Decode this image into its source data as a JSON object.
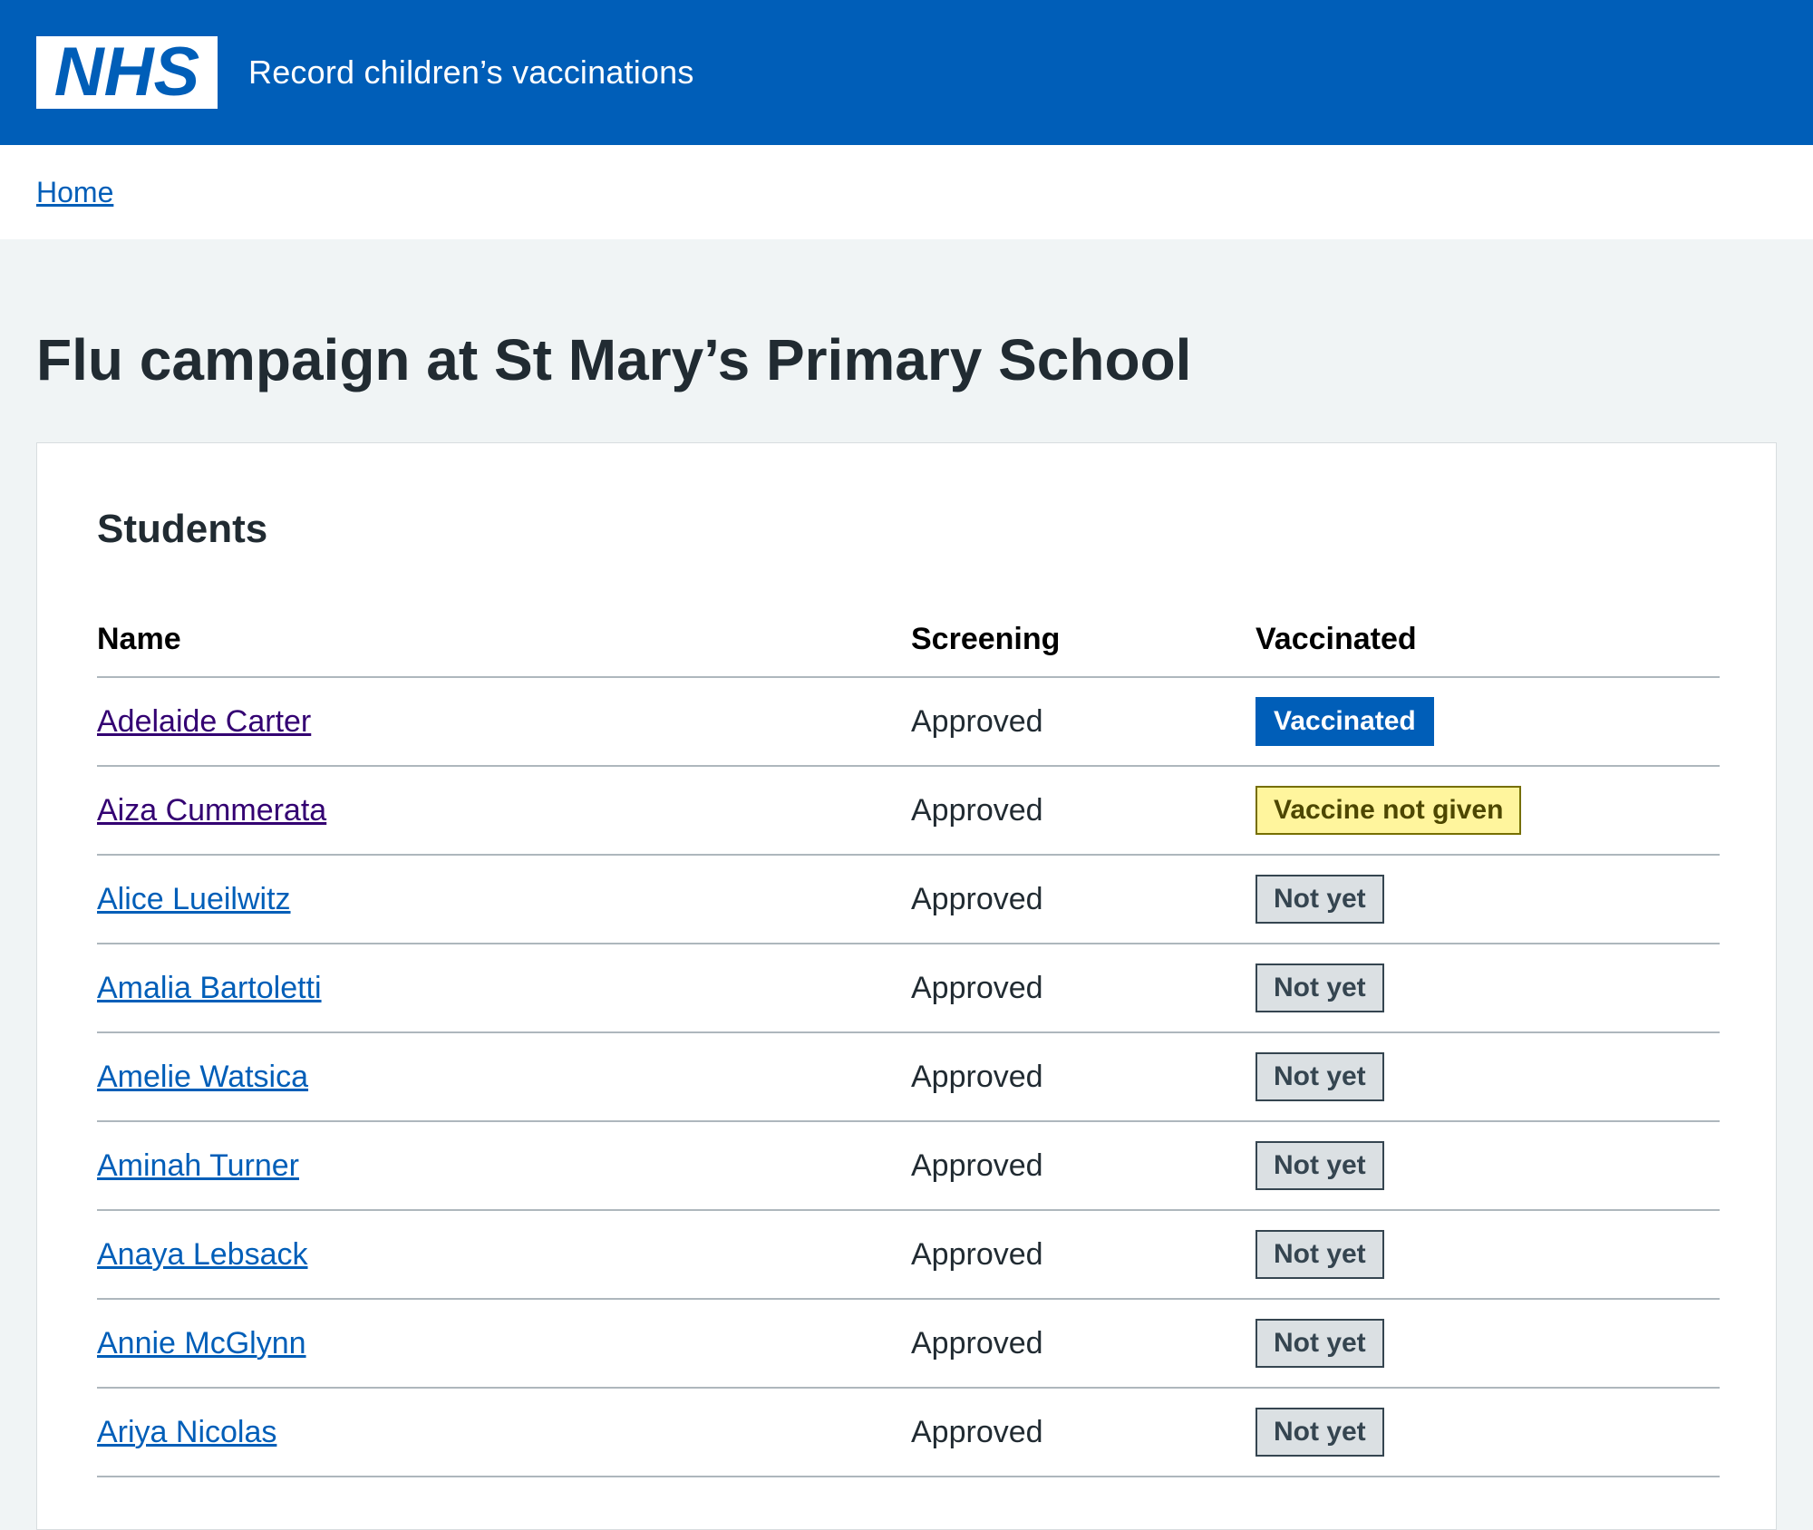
{
  "header": {
    "logo_text": "NHS",
    "service_name": "Record children’s vaccinations"
  },
  "breadcrumb": {
    "home": "Home"
  },
  "page_title": "Flu campaign at St Mary’s Primary School",
  "students": {
    "heading": "Students",
    "columns": [
      "Name",
      "Screening",
      "Vaccinated"
    ],
    "rows": [
      {
        "name": "Adelaide Carter",
        "screening": "Approved",
        "vaccinated": "Vaccinated"
      },
      {
        "name": "Aiza Cummerata",
        "screening": "Approved",
        "vaccinated": "Vaccine not given"
      },
      {
        "name": "Alice Lueilwitz",
        "screening": "Approved",
        "vaccinated": "Not yet"
      },
      {
        "name": "Amalia Bartoletti",
        "screening": "Approved",
        "vaccinated": "Not yet"
      },
      {
        "name": "Amelie Watsica",
        "screening": "Approved",
        "vaccinated": "Not yet"
      },
      {
        "name": "Aminah Turner",
        "screening": "Approved",
        "vaccinated": "Not yet"
      },
      {
        "name": "Anaya Lebsack",
        "screening": "Approved",
        "vaccinated": "Not yet"
      },
      {
        "name": "Annie McGlynn",
        "screening": "Approved",
        "vaccinated": "Not yet"
      },
      {
        "name": "Ariya Nicolas",
        "screening": "Approved",
        "vaccinated": "Not yet"
      }
    ]
  },
  "colors": {
    "header_blue": "#005eb8",
    "page_bg": "#f0f4f5",
    "tag_vaccinated": "#005eb8",
    "tag_not_given": "#fff59d",
    "tag_not_yet": "#dbe0e3"
  }
}
